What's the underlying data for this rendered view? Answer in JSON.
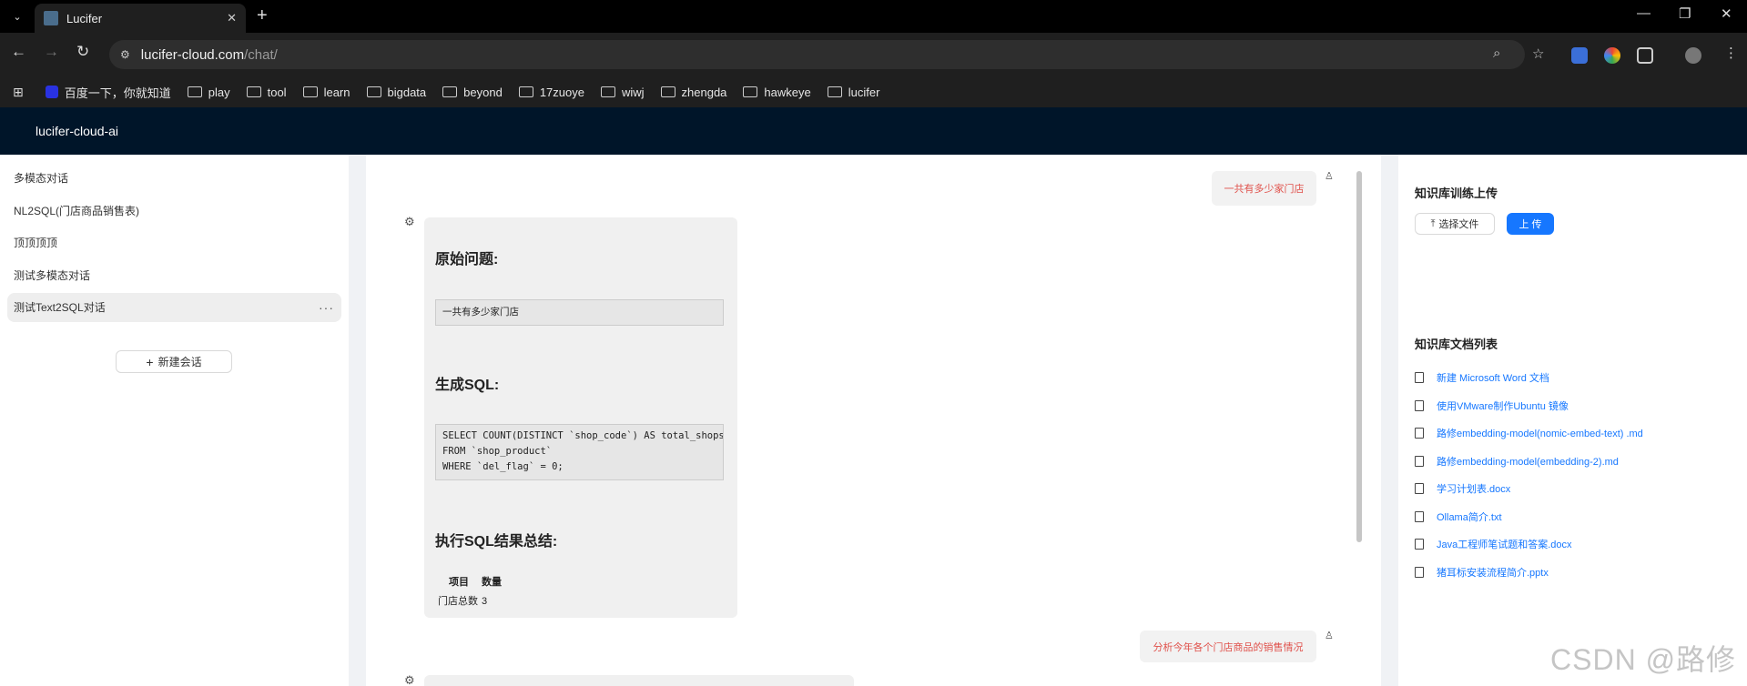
{
  "browser": {
    "tab_title": "Lucifer",
    "url_host": "lucifer-cloud.com",
    "url_path": "/chat/",
    "bookmarks": [
      {
        "label": "百度一下，你就知道",
        "icon": "baidu-icon"
      },
      {
        "label": "play",
        "icon": "folder-icon"
      },
      {
        "label": "tool",
        "icon": "folder-icon"
      },
      {
        "label": "learn",
        "icon": "folder-icon"
      },
      {
        "label": "bigdata",
        "icon": "folder-icon"
      },
      {
        "label": "beyond",
        "icon": "folder-icon"
      },
      {
        "label": "17zuoye",
        "icon": "folder-icon"
      },
      {
        "label": "wiwj",
        "icon": "folder-icon"
      },
      {
        "label": "zhengda",
        "icon": "folder-icon"
      },
      {
        "label": "hawkeye",
        "icon": "folder-icon"
      },
      {
        "label": "lucifer",
        "icon": "folder-icon"
      }
    ]
  },
  "header": {
    "title": "lucifer-cloud-ai"
  },
  "sidebar": {
    "conversations": [
      {
        "label": "多模态对话"
      },
      {
        "label": "NL2SQL(门店商品销售表)"
      },
      {
        "label": "顶顶顶顶"
      },
      {
        "label": "测试多模态对话"
      },
      {
        "label": "测试Text2SQL对话",
        "active": true
      }
    ],
    "more_label": "···",
    "new_conversation_label": "新建会话"
  },
  "chat": {
    "messages": [
      {
        "role": "user",
        "text": "一共有多少家门店"
      },
      {
        "role": "bot",
        "original_question_heading": "原始问题:",
        "original_question": "一共有多少家门店",
        "sql_heading": "生成SQL:",
        "sql_lines": [
          "SELECT COUNT(DISTINCT `shop_code`) AS total_shops",
          "FROM `shop_product`",
          "WHERE `del_flag` = 0;"
        ],
        "summary_heading": "执行SQL结果总结:",
        "table_headers": [
          "项目",
          "数量"
        ],
        "table_rows": [
          [
            "门店总数",
            "3"
          ]
        ]
      },
      {
        "role": "user",
        "text": "分析今年各个门店商品的销售情况"
      }
    ]
  },
  "knowledge": {
    "upload_title": "知识库训练上传",
    "select_file_label": "选择文件",
    "upload_label": "上 传",
    "docs_title": "知识库文档列表",
    "documents": [
      "新建 Microsoft Word 文档",
      "使用VMware制作Ubuntu 镜像",
      "路修embedding-model(nomic-embed-text) .md",
      "路修embedding-model(embedding-2).md",
      "学习计划表.docx",
      "Ollama简介.txt",
      "Java工程师笔试题和答案.docx",
      "猪耳标安装流程简介.pptx"
    ]
  },
  "watermark": "CSDN @路修",
  "colors": {
    "header_bg": "#001529",
    "primary": "#1677ff",
    "user_text": "#e0524c"
  }
}
